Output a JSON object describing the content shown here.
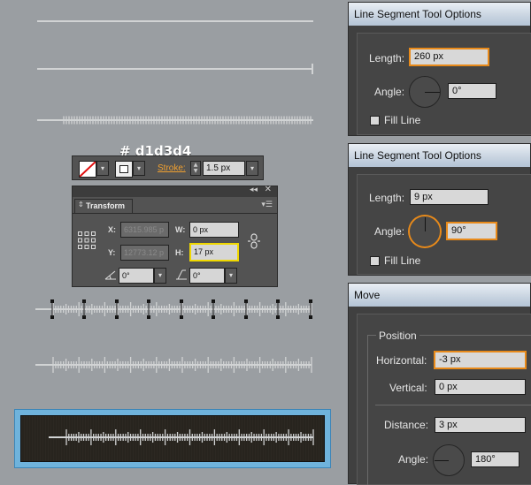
{
  "color_label": "# d1d3d4",
  "colors": {
    "line": "#d1d3d4",
    "canvas": "#9a9ea2",
    "accent": "#e88a1a",
    "selection": "#f0d800"
  },
  "dialog1": {
    "title": "Line Segment Tool Options",
    "length_label": "Length:",
    "length_value": "260 px",
    "angle_label": "Angle:",
    "angle_value": "0°",
    "fill_label": "Fill Line"
  },
  "dialog2": {
    "title": "Line Segment Tool Options",
    "length_label": "Length:",
    "length_value": "9 px",
    "angle_label": "Angle:",
    "angle_value": "90°",
    "fill_label": "Fill Line"
  },
  "dialog3": {
    "title": "Move",
    "section": "Position",
    "horizontal_label": "Horizontal:",
    "horizontal_value": "-3 px",
    "vertical_label": "Vertical:",
    "vertical_value": "0 px",
    "distance_label": "Distance:",
    "distance_value": "3 px",
    "angle_label": "Angle:",
    "angle_value": "180°"
  },
  "control_bar": {
    "stroke_label": "Stroke:",
    "stroke_value": "1.5 px"
  },
  "transform": {
    "tab_label": "Transform",
    "x_label": "X:",
    "x_value": "6315.985 p",
    "y_label": "Y:",
    "y_value": "12773.12 p",
    "w_label": "W:",
    "w_value": "0 px",
    "h_label": "H:",
    "h_value": "17 px",
    "rotate_value": "0°",
    "shear_value": "0°"
  }
}
